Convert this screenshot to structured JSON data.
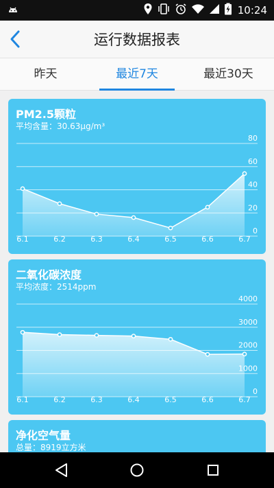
{
  "status_bar": {
    "time": "10:24"
  },
  "app_bar": {
    "title": "运行数据报表"
  },
  "tabs": [
    {
      "label": "昨天",
      "active": false
    },
    {
      "label": "最近7天",
      "active": true
    },
    {
      "label": "最近30天",
      "active": false
    }
  ],
  "colors": {
    "accent": "#1f86e0",
    "card": "#4cc7f2"
  },
  "cards": [
    {
      "title": "PM2.5颗粒",
      "subtitle": "平均含量：30.63μg/m³"
    },
    {
      "title": "二氧化碳浓度",
      "subtitle": "平均浓度：2514ppm"
    },
    {
      "title": "净化空气量",
      "subtitle": "总量：8919立方米"
    }
  ],
  "chart_data": [
    {
      "type": "area",
      "title": "PM2.5颗粒",
      "subtitle": "平均含量：30.63μg/m³",
      "categories": [
        "6.1",
        "6.2",
        "6.3",
        "6.4",
        "6.5",
        "6.6",
        "6.7"
      ],
      "values": [
        41,
        28,
        19,
        16,
        7,
        25,
        54
      ],
      "yticks": [
        0,
        20,
        40,
        60,
        80
      ],
      "ylim": [
        0,
        80
      ],
      "grid": true
    },
    {
      "type": "area",
      "title": "二氧化碳浓度",
      "subtitle": "平均浓度：2514ppm",
      "categories": [
        "6.1",
        "6.2",
        "6.3",
        "6.4",
        "6.5",
        "6.6",
        "6.7"
      ],
      "values": [
        2780,
        2680,
        2650,
        2620,
        2480,
        1830,
        1840
      ],
      "yticks": [
        0,
        1000,
        2000,
        3000,
        4000
      ],
      "ylim": [
        0,
        4000
      ],
      "grid": true
    }
  ]
}
